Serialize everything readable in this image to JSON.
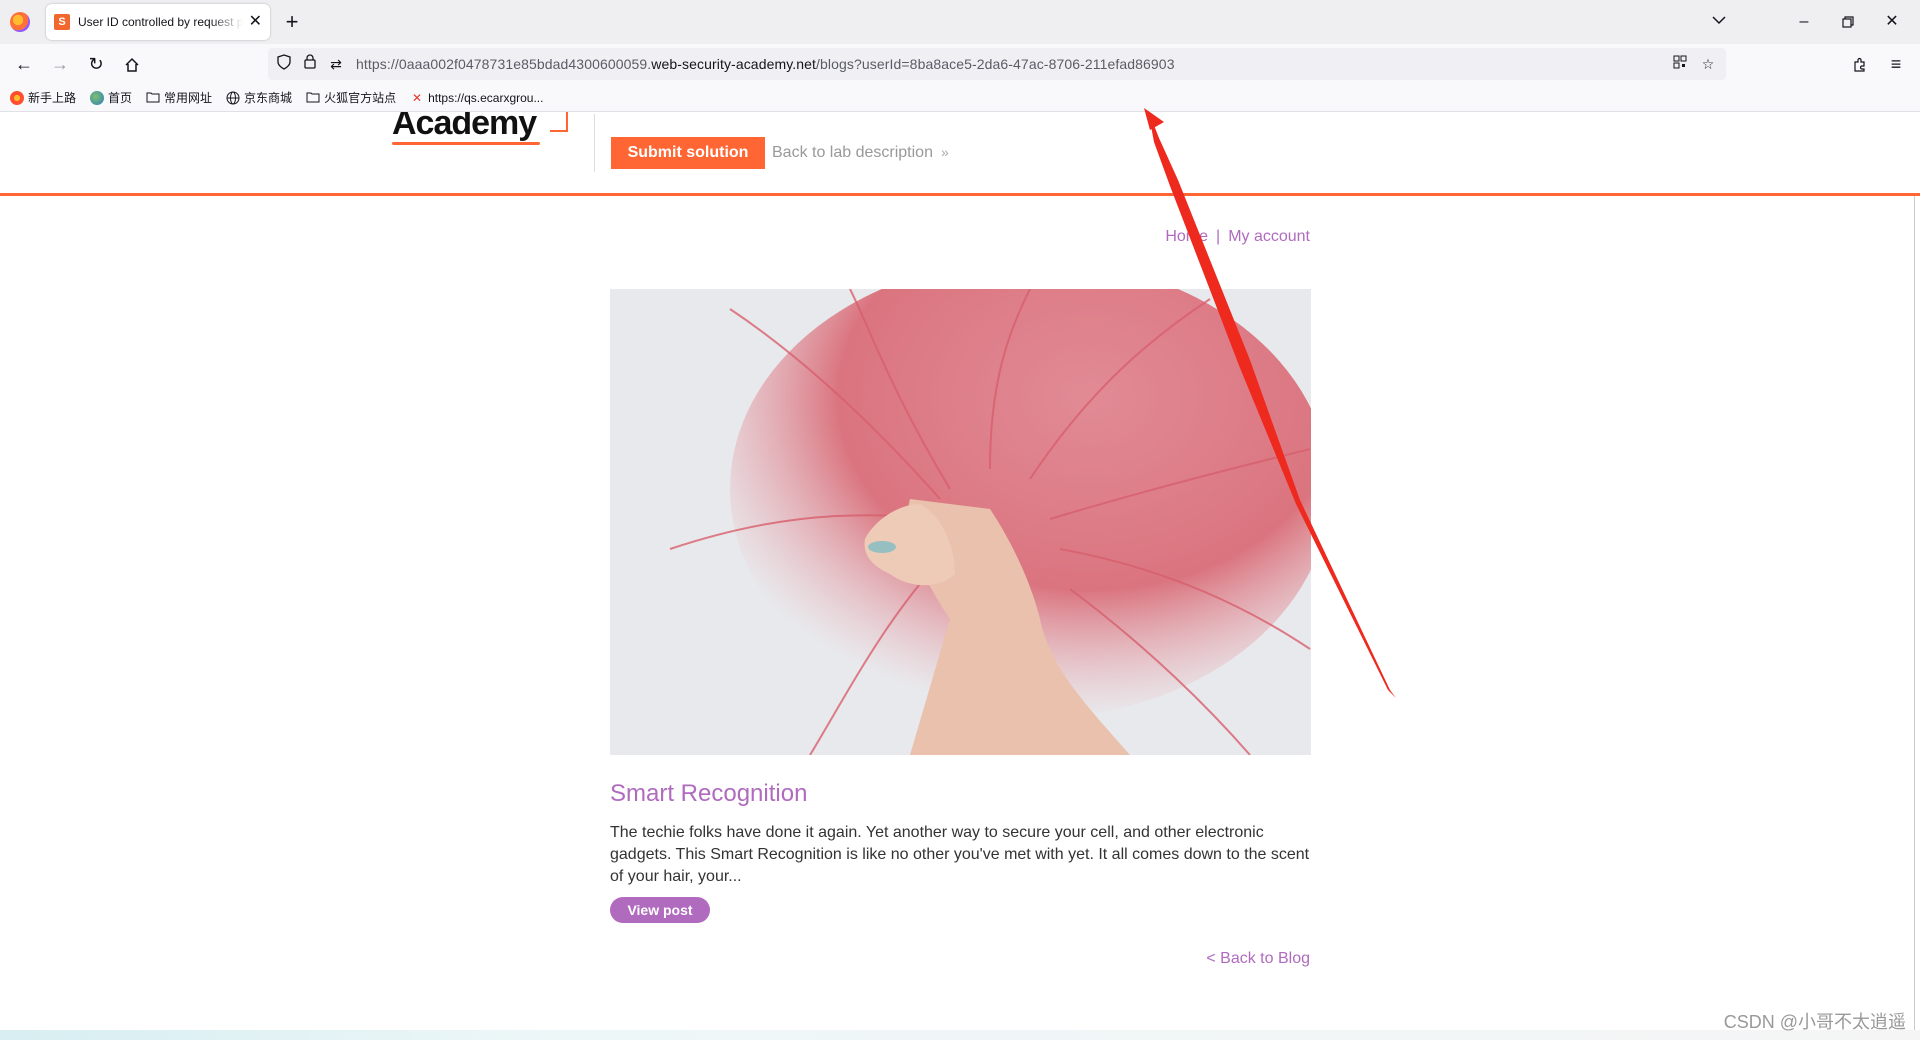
{
  "browser": {
    "tab_title": "User ID controlled by request parameter",
    "tab_favicon_letter": "S",
    "url_prefix": "https://0aaa002f0478731e85bdad4300600059.",
    "url_host": "web-security-academy.net",
    "url_path": "/blogs?userId=8ba8ace5-2da6-47ac-8706-211efad86903",
    "bookmarks": [
      {
        "label": "新手上路",
        "icon": "firefox-icon"
      },
      {
        "label": "首页",
        "icon": "globe-color-icon"
      },
      {
        "label": "常用网址",
        "icon": "folder-icon"
      },
      {
        "label": "京东商城",
        "icon": "globe-icon"
      },
      {
        "label": "火狐官方站点",
        "icon": "folder-icon"
      },
      {
        "label": "https://qs.ecarxgrou...",
        "icon": "x-icon"
      }
    ]
  },
  "header": {
    "logo_text": "Academy",
    "submit_label": "Submit solution",
    "lab_link_label": "Back to lab description"
  },
  "nav": {
    "home_label": "Home",
    "separator": "|",
    "account_label": "My account"
  },
  "post": {
    "title": "Smart Recognition",
    "excerpt": "The techie folks have done it again. Yet another way to secure your cell, and other electronic gadgets. This Smart Recognition is like no other you've met with yet. It all comes down to the scent of your hair, your...",
    "view_label": "View post",
    "back_label": "< Back to Blog"
  },
  "watermark": "CSDN @小哥不太逍遥",
  "colors": {
    "accent_orange": "#ff6633",
    "link_purple": "#b06bbf",
    "annotation_arrow": "#ee2a1f"
  }
}
